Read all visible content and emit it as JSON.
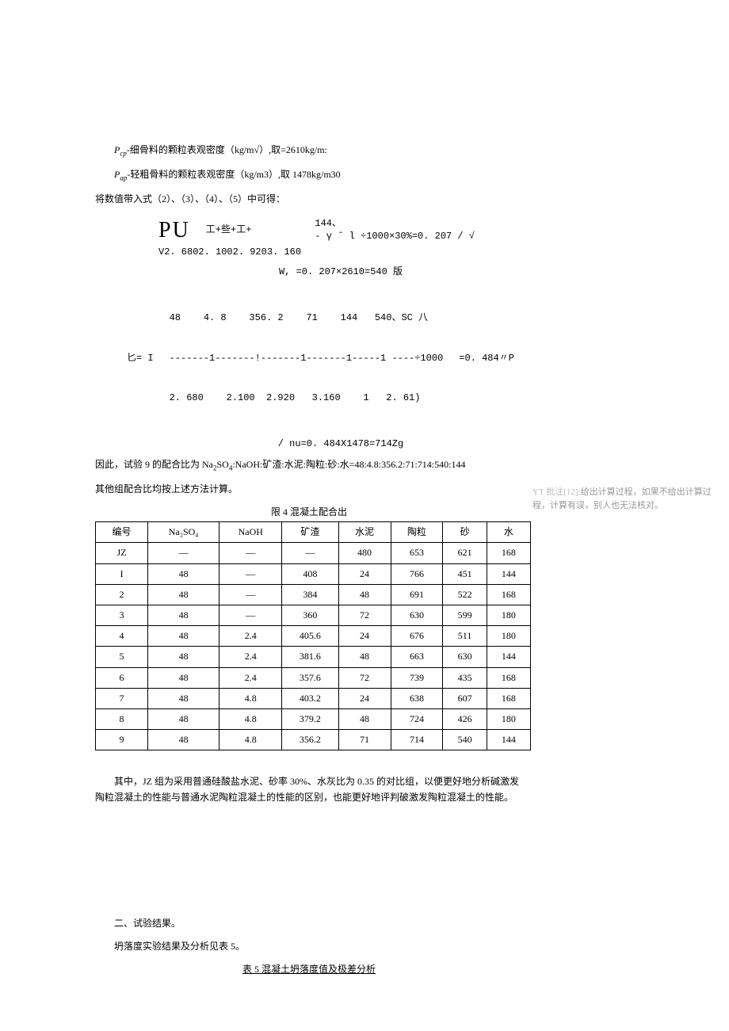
{
  "def1_prefix": "P",
  "def1_sub": "cp",
  "def1_text": "-细骨料的颗粒表观密度（kg/m√）,取=2610kg/m:",
  "def2_prefix": "P",
  "def2_sub": "ap",
  "def2_text": "-轻粗骨料的颗粒表观密度（kg/m3）,取 1478kg/m30",
  "lead_in": "将数值带入式（2）、（3）、（4）、（5）中可得：",
  "eq1_left": "PU",
  "eq1_mid": "工+些+工+",
  "eq1_r1": "144、",
  "eq1_r2": "- γ ˆ l ÷1000×30%=0. 207 /  √",
  "eq1_bottom": "V2. 6802. 1002. 9203. 160",
  "eq2": "W, =0. 207×2610=540 版",
  "eq3_label": "匕= I",
  "eq3_top": "48    4. 8    356. 2    71    144   540、SC 八",
  "eq3_mid": "-------1-------!-------1-------1-----1 ----÷1000",
  "eq3_bot": "2. 680    2.100  2.920   3.160    1   2. 61)",
  "eq3_res": "=0. 484〃P",
  "eq4": "/ nu=0. 484X1478=714Zg",
  "ratio_text_a": "因此，试验 9 的配合比为 Na",
  "ratio_text_b": "SO",
  "ratio_text_c": ":NaOH:矿渣:水泥:陶粒:砂:水=48:4.8:356.2:71:714:540:144",
  "other_text": "其他组配合比均按上述方法计算。",
  "table4_caption": "限 4 混凝土配合出",
  "table4": {
    "headers": [
      "编号",
      "Na₂SO₄",
      "NaOH",
      "矿渣",
      "水泥",
      "陶粒",
      "砂",
      "水"
    ],
    "rows": [
      [
        "JZ",
        "—",
        "—",
        "—",
        "480",
        "653",
        "621",
        "168"
      ],
      [
        "I",
        "48",
        "—",
        "408",
        "24",
        "766",
        "451",
        "144"
      ],
      [
        "2",
        "48",
        "—",
        "384",
        "48",
        "691",
        "522",
        "168"
      ],
      [
        "3",
        "48",
        "—",
        "360",
        "72",
        "630",
        "599",
        "180"
      ],
      [
        "4",
        "48",
        "2.4",
        "405.6",
        "24",
        "676",
        "511",
        "180"
      ],
      [
        "5",
        "48",
        "2.4",
        "381.6",
        "48",
        "663",
        "630",
        "144"
      ],
      [
        "6",
        "48",
        "2.4",
        "357.6",
        "72",
        "739",
        "435",
        "168"
      ],
      [
        "7",
        "48",
        "4.8",
        "403.2",
        "24",
        "638",
        "607",
        "168"
      ],
      [
        "8",
        "48",
        "4.8",
        "379.2",
        "48",
        "724",
        "426",
        "180"
      ],
      [
        "9",
        "48",
        "4.8",
        "356.2",
        "71",
        "714",
        "540",
        "144"
      ]
    ]
  },
  "comment_label": "YT 批注[12]:",
  "comment_text": "给出计算过程，如果不给出计算过程，计算有误，别人也无法核对。",
  "para_jz": "其中，JZ 组为采用普通硅酸盐水泥、砂率 30%、水灰比为 0.35 的对比组，以便更好地分析碱激发陶粒混凝土的性能与普通水泥陶粒混凝土的性能的区别，也能更好地评判破激发陶粒混凝土的性能。",
  "section2": "二、试验结果。",
  "section2_sub": "坍落度实验结果及分析见表 5。",
  "table5_caption": "表 5 混凝土坍落度值及极差分析"
}
